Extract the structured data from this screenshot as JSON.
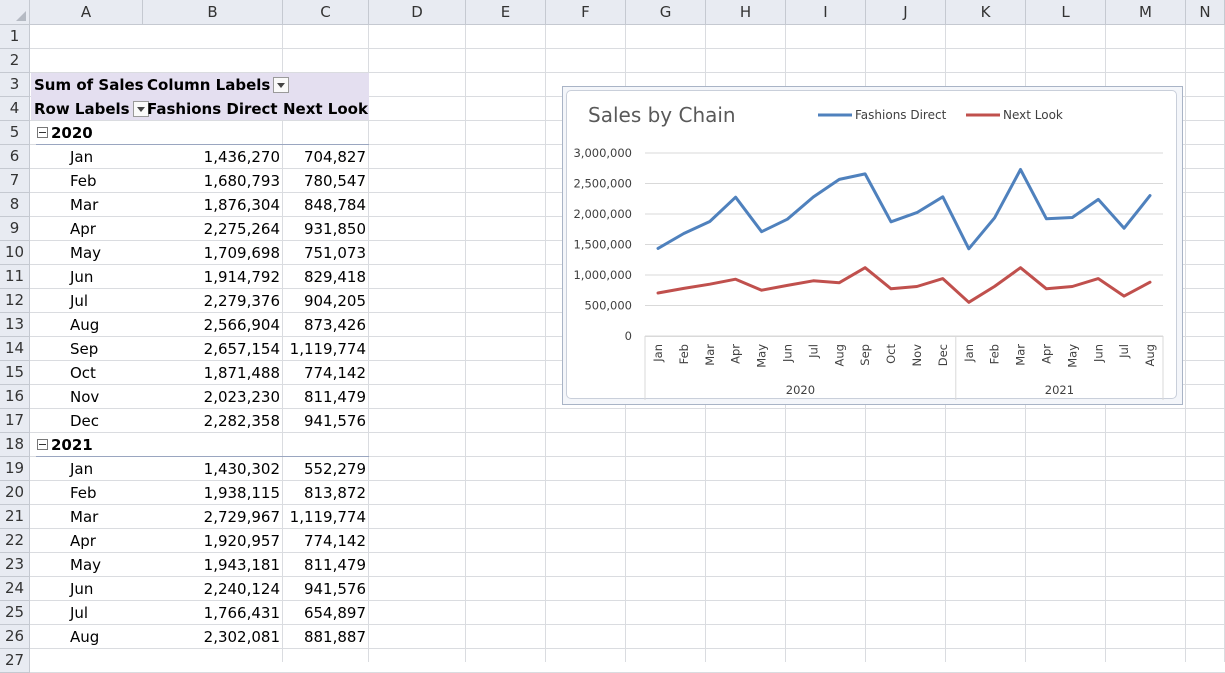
{
  "columns": [
    "A",
    "B",
    "C",
    "D",
    "E",
    "F",
    "G",
    "H",
    "I",
    "J",
    "K",
    "L",
    "M",
    "N"
  ],
  "rows": [
    "1",
    "2",
    "3",
    "4",
    "5",
    "6",
    "7",
    "8",
    "9",
    "10",
    "11",
    "12",
    "13",
    "14",
    "15",
    "16",
    "17",
    "18",
    "19",
    "20",
    "21",
    "22",
    "23",
    "24",
    "25",
    "26",
    "27"
  ],
  "pivot": {
    "sum_label": "Sum of Sales",
    "column_labels": "Column Labels",
    "row_labels": "Row Labels",
    "col1": "Fashions Direct",
    "col2": "Next Look",
    "groups": [
      {
        "year": "2020",
        "rows": [
          {
            "month": "Jan",
            "fd": "1,436,270",
            "nl": "704,827"
          },
          {
            "month": "Feb",
            "fd": "1,680,793",
            "nl": "780,547"
          },
          {
            "month": "Mar",
            "fd": "1,876,304",
            "nl": "848,784"
          },
          {
            "month": "Apr",
            "fd": "2,275,264",
            "nl": "931,850"
          },
          {
            "month": "May",
            "fd": "1,709,698",
            "nl": "751,073"
          },
          {
            "month": "Jun",
            "fd": "1,914,792",
            "nl": "829,418"
          },
          {
            "month": "Jul",
            "fd": "2,279,376",
            "nl": "904,205"
          },
          {
            "month": "Aug",
            "fd": "2,566,904",
            "nl": "873,426"
          },
          {
            "month": "Sep",
            "fd": "2,657,154",
            "nl": "1,119,774"
          },
          {
            "month": "Oct",
            "fd": "1,871,488",
            "nl": "774,142"
          },
          {
            "month": "Nov",
            "fd": "2,023,230",
            "nl": "811,479"
          },
          {
            "month": "Dec",
            "fd": "2,282,358",
            "nl": "941,576"
          }
        ]
      },
      {
        "year": "2021",
        "rows": [
          {
            "month": "Jan",
            "fd": "1,430,302",
            "nl": "552,279"
          },
          {
            "month": "Feb",
            "fd": "1,938,115",
            "nl": "813,872"
          },
          {
            "month": "Mar",
            "fd": "2,729,967",
            "nl": "1,119,774"
          },
          {
            "month": "Apr",
            "fd": "1,920,957",
            "nl": "774,142"
          },
          {
            "month": "May",
            "fd": "1,943,181",
            "nl": "811,479"
          },
          {
            "month": "Jun",
            "fd": "2,240,124",
            "nl": "941,576"
          },
          {
            "month": "Jul",
            "fd": "1,766,431",
            "nl": "654,897"
          },
          {
            "month": "Aug",
            "fd": "2,302,081",
            "nl": "881,887"
          }
        ]
      }
    ]
  },
  "chart_data": {
    "type": "line",
    "title": "Sales by Chain",
    "categories": [
      "Jan",
      "Feb",
      "Mar",
      "Apr",
      "May",
      "Jun",
      "Jul",
      "Aug",
      "Sep",
      "Oct",
      "Nov",
      "Dec",
      "Jan",
      "Feb",
      "Mar",
      "Apr",
      "May",
      "Jun",
      "Jul",
      "Aug"
    ],
    "category_groups": [
      {
        "label": "2020",
        "count": 12
      },
      {
        "label": "2021",
        "count": 8
      }
    ],
    "series": [
      {
        "name": "Fashions Direct",
        "color": "#4f81bd",
        "values": [
          1436270,
          1680793,
          1876304,
          2275264,
          1709698,
          1914792,
          2279376,
          2566904,
          2657154,
          1871488,
          2023230,
          2282358,
          1430302,
          1938115,
          2729967,
          1920957,
          1943181,
          2240124,
          1766431,
          2302081
        ]
      },
      {
        "name": "Next Look",
        "color": "#c0504d",
        "values": [
          704827,
          780547,
          848784,
          931850,
          751073,
          829418,
          904205,
          873426,
          1119774,
          774142,
          811479,
          941576,
          552279,
          813872,
          1119774,
          774142,
          811479,
          941576,
          654897,
          881887
        ]
      }
    ],
    "ylim": [
      0,
      3000000
    ],
    "yticks": [
      "0",
      "500,000",
      "1,000,000",
      "1,500,000",
      "2,000,000",
      "2,500,000",
      "3,000,000"
    ],
    "grid": true,
    "legend": "top-right"
  }
}
